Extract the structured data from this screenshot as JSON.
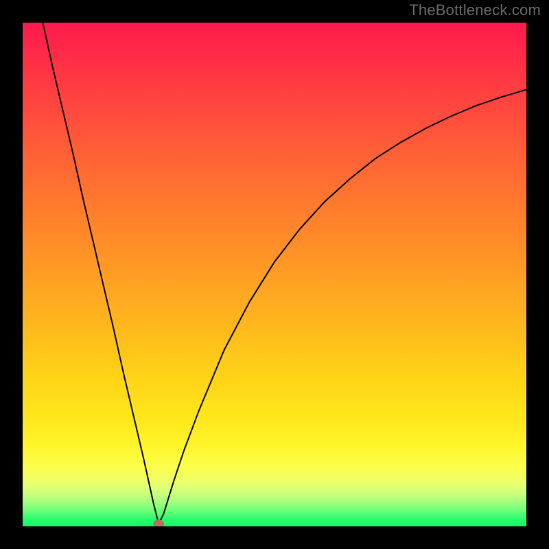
{
  "attribution": "TheBottleneck.com",
  "chart_data": {
    "type": "line",
    "title": "",
    "xlabel": "",
    "ylabel": "",
    "xlim": [
      0,
      100
    ],
    "ylim": [
      0,
      100
    ],
    "grid": false,
    "legend": false,
    "background_gradient": [
      "#ff1a4d",
      "#11f567"
    ],
    "series": [
      {
        "name": "bottleneck-curve",
        "description": "V-shaped bottleneck curve descending steeply from top-left to a minimum near x≈27 then rising asymptotically toward the right.",
        "x": [
          4,
          6,
          8,
          10,
          12,
          14,
          16,
          18,
          20,
          22,
          24,
          26,
          27,
          28,
          30,
          32,
          35,
          40,
          45,
          50,
          55,
          60,
          65,
          70,
          75,
          80,
          85,
          90,
          95,
          100
        ],
        "y": [
          100,
          91,
          82.5,
          74,
          65,
          56.5,
          48,
          39.5,
          30.5,
          22,
          13.5,
          4.5,
          0.5,
          2.5,
          9,
          15,
          23,
          35,
          44.5,
          52.5,
          59,
          64.5,
          69,
          73,
          76.2,
          79,
          81.4,
          83.5,
          85.2,
          86.7
        ]
      }
    ],
    "marker": {
      "x": 27,
      "y": 0.5,
      "color": "#c16b5d"
    }
  }
}
